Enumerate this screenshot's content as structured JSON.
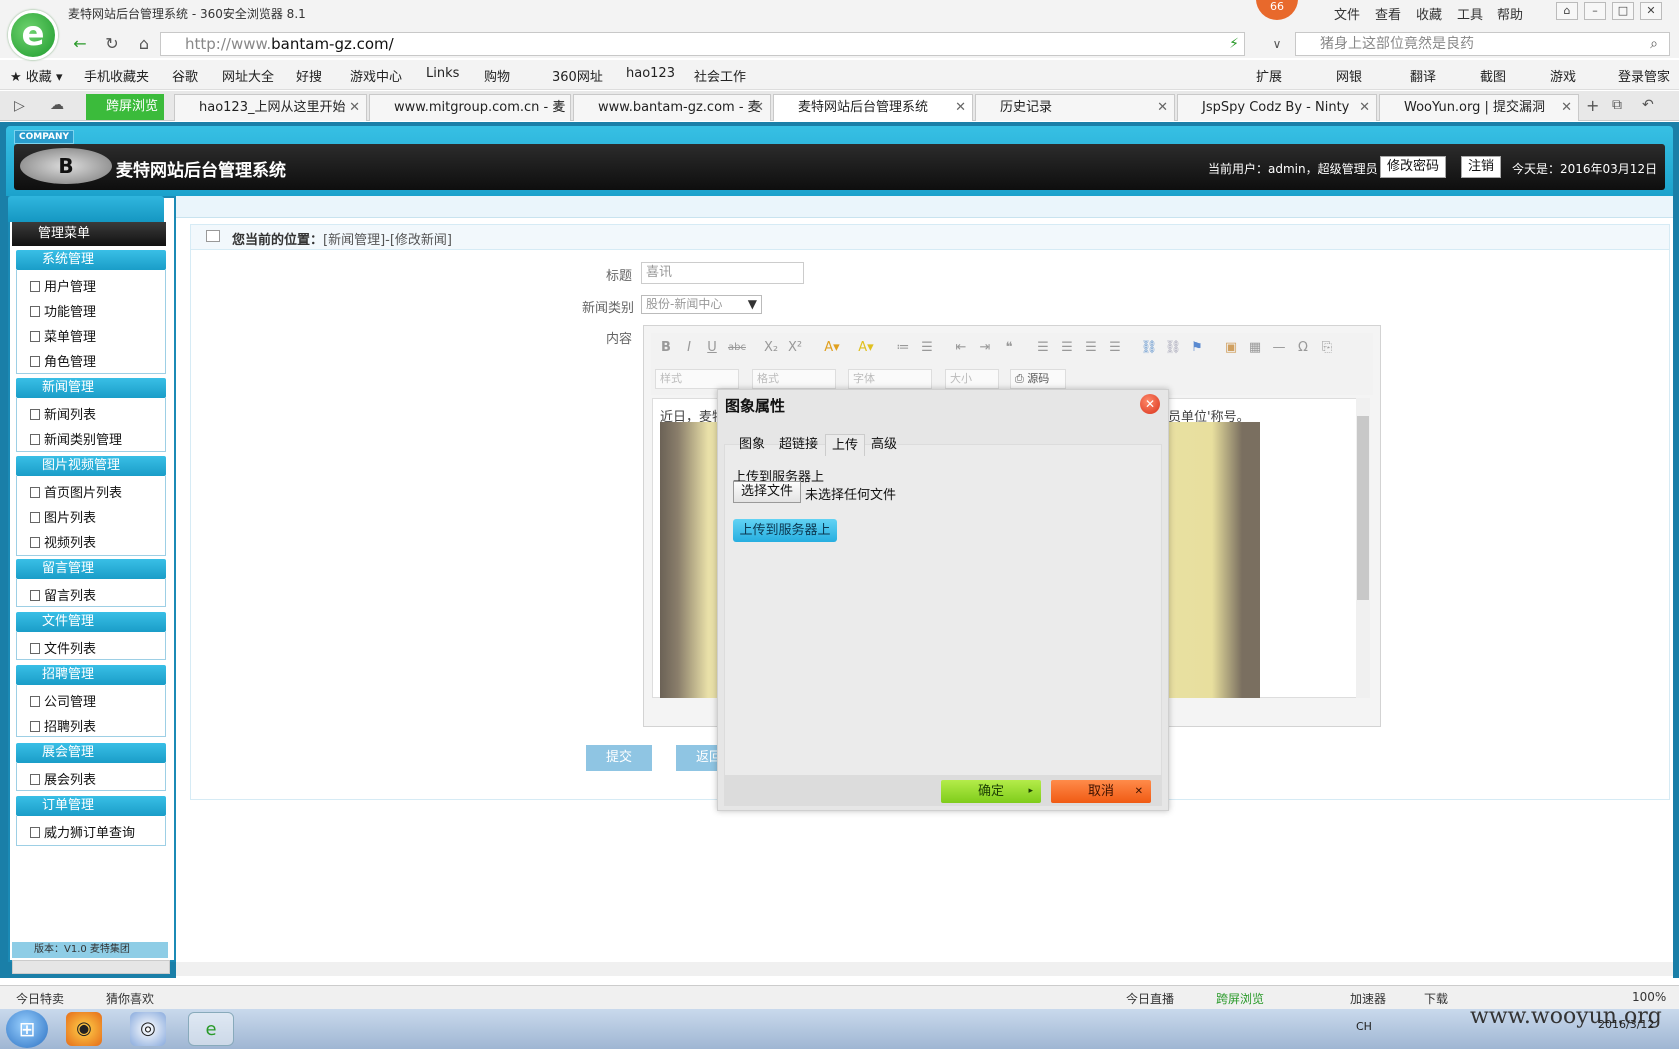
{
  "browser": {
    "window_title": "麦特网站后台管理系统 - 360安全浏览器 8.1",
    "badge": "66",
    "menu": [
      "文件",
      "查看",
      "收藏",
      "工具",
      "帮助"
    ],
    "url_prefix": "http://www.",
    "url_host": "bantam-gz.com/",
    "search_placeholder": "猪身上这部位竟然是良药",
    "bookmarks_left": [
      "收藏",
      "手机收藏夹",
      "谷歌",
      "网址大全",
      "好搜",
      "游戏中心",
      "Links",
      "购物",
      "360网址",
      "hao123",
      "社会工作"
    ],
    "bookmarks_right": [
      "扩展",
      "网银",
      "翻译",
      "截图",
      "游戏",
      "登录管家"
    ],
    "green_tab": "跨屏浏览",
    "tabs": [
      {
        "label": "hao123_上网从这里开始"
      },
      {
        "label": "www.mitgroup.com.cn - 麦"
      },
      {
        "label": "www.bantam-gz.com - 麦"
      },
      {
        "label": "麦特网站后台管理系统"
      },
      {
        "label": "历史记录"
      },
      {
        "label": "JspSpy Codz By - Ninty"
      },
      {
        "label": "WooYun.org | 提交漏洞"
      }
    ]
  },
  "header": {
    "company": "COMPANY",
    "logo": "B",
    "title": "麦特网站后台管理系统",
    "user_info": "当前用户：admin，超级管理员",
    "change_password": "修改密码",
    "logout": "注销",
    "today": "今天是：2016年03月12日"
  },
  "sidebar": {
    "title": "管理菜单",
    "groups": [
      {
        "label": "系统管理",
        "items": [
          "用户管理",
          "功能管理",
          "菜单管理",
          "角色管理"
        ]
      },
      {
        "label": "新闻管理",
        "items": [
          "新闻列表",
          "新闻类别管理"
        ]
      },
      {
        "label": "图片视频管理",
        "items": [
          "首页图片列表",
          "图片列表",
          "视频列表"
        ]
      },
      {
        "label": "留言管理",
        "items": [
          "留言列表"
        ]
      },
      {
        "label": "文件管理",
        "items": [
          "文件列表"
        ]
      },
      {
        "label": "招聘管理",
        "items": [
          "公司管理",
          "招聘列表"
        ]
      },
      {
        "label": "展会管理",
        "items": [
          "展会列表"
        ]
      },
      {
        "label": "订单管理",
        "items": [
          "威力狮订单查询"
        ]
      }
    ],
    "version": "版本：V1.0 麦特集团"
  },
  "content": {
    "breadcrumb_prefix": "您当前的位置：",
    "breadcrumb": "[新闻管理]-[修改新闻]",
    "title_label": "标题",
    "title_value": "喜讯",
    "category_label": "新闻类别",
    "category_value": "股份-新闻中心",
    "content_label": "内容",
    "toolbar_selects": [
      "样式",
      "格式",
      "字体",
      "大小"
    ],
    "source_button": "源码",
    "editor_text_left": "近日，麦特",
    "editor_text_right": "员单位'称号。",
    "submit": "提交",
    "back": "返回"
  },
  "dialog": {
    "title": "图象属性",
    "tabs": [
      "图象",
      "超链接",
      "上传",
      "高级"
    ],
    "active_tab": "上传",
    "upload_label": "上传到服务器上",
    "choose_file": "选择文件",
    "no_file": "未选择任何文件",
    "upload_button": "上传到服务器上",
    "ok": "确定",
    "cancel": "取消"
  },
  "statusbar": {
    "left": [
      "今日特卖",
      "猜你喜欢"
    ],
    "right": [
      "今日直播",
      "跨屏浏览",
      "加速器",
      "下载"
    ],
    "zoom": "100%"
  },
  "taskbar": {
    "lang": "CH",
    "time": "2016/3/12",
    "watermark": "www.wooyun.org"
  }
}
